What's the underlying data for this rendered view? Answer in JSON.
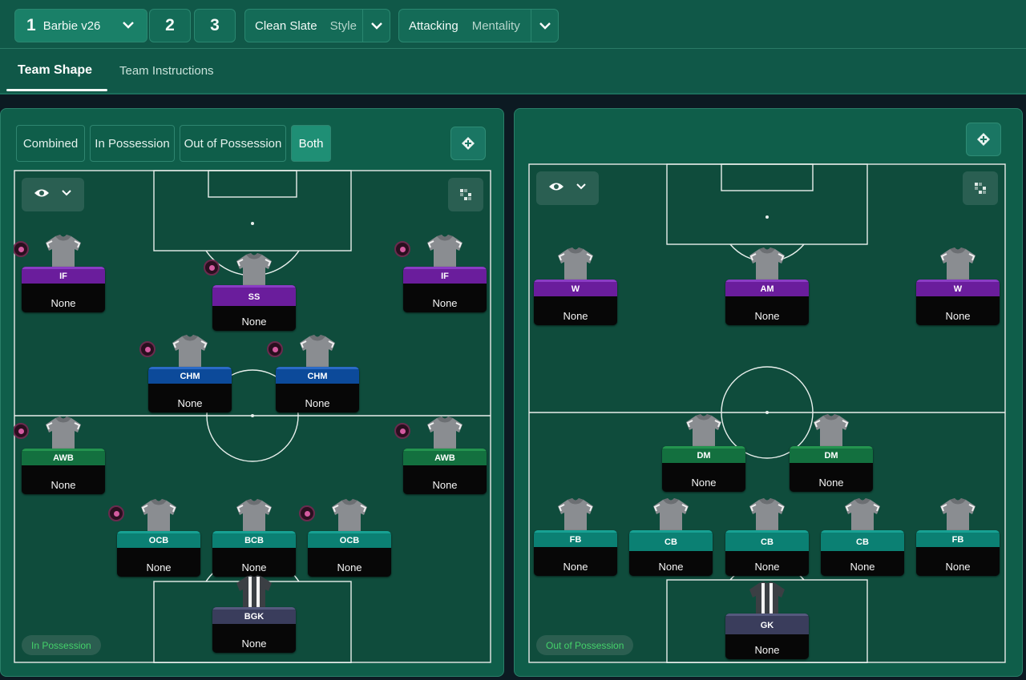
{
  "header": {
    "tactic_number": "1",
    "tactic_name": "Barbie v26",
    "slot2": "2",
    "slot3": "3",
    "style_value": "Clean Slate",
    "style_label": "Style",
    "mentality_value": "Attacking",
    "mentality_label": "Mentality",
    "tabs": [
      "Team Shape",
      "Team Instructions"
    ],
    "active_tab": "Team Shape"
  },
  "left_panel": {
    "segments": [
      "Combined",
      "In Possession",
      "Out of Possession",
      "Both"
    ],
    "active_segment": "Both",
    "phase_label": "In Possession",
    "players": [
      {
        "role": "IF",
        "name": "None",
        "color": "purple",
        "badge": true
      },
      {
        "role": "S\nS",
        "name": "None",
        "color": "purple",
        "badge": true
      },
      {
        "role": "IF",
        "name": "None",
        "color": "purple",
        "badge": true
      },
      {
        "role": "CHM",
        "name": "None",
        "color": "blue",
        "badge": true
      },
      {
        "role": "CHM",
        "name": "None",
        "color": "blue",
        "badge": true
      },
      {
        "role": "AWB",
        "name": "None",
        "color": "green",
        "badge": true
      },
      {
        "role": "AWB",
        "name": "None",
        "color": "green",
        "badge": true
      },
      {
        "role": "OCB",
        "name": "None",
        "color": "teal",
        "badge": true
      },
      {
        "role": "BCB",
        "name": "None",
        "color": "teal",
        "badge": false
      },
      {
        "role": "OCB",
        "name": "None",
        "color": "teal",
        "badge": true
      },
      {
        "role": "BGK",
        "name": "None",
        "color": "slate",
        "badge": false
      }
    ]
  },
  "right_panel": {
    "phase_label": "Out of Possession",
    "players": [
      {
        "role": "W",
        "name": "None",
        "color": "purple"
      },
      {
        "role": "AM",
        "name": "None",
        "color": "purple"
      },
      {
        "role": "W",
        "name": "None",
        "color": "purple"
      },
      {
        "role": "DM",
        "name": "None",
        "color": "green"
      },
      {
        "role": "DM",
        "name": "None",
        "color": "green"
      },
      {
        "role": "FB",
        "name": "None",
        "color": "teal"
      },
      {
        "role": "C\nB",
        "name": "None",
        "color": "teal"
      },
      {
        "role": "C\nB",
        "name": "None",
        "color": "teal"
      },
      {
        "role": "C\nB",
        "name": "None",
        "color": "teal"
      },
      {
        "role": "FB",
        "name": "None",
        "color": "teal"
      },
      {
        "role": "G\nK",
        "name": "None",
        "color": "slate"
      }
    ]
  },
  "colors": {
    "accent": "#1f8f75",
    "purple": "#6a1d9c",
    "blue": "#0c4a9a",
    "green": "#13703f",
    "teal": "#0b8073",
    "slate": "#3a3d5c",
    "possession_text": "#44d16a"
  },
  "icons": {
    "tactic_chevron": "chevron-down-icon",
    "visibility": "eye-icon",
    "grid": "grid-icon",
    "swap": "swap-diamond-icon",
    "playmaker_badge": "playmaker-badge-icon"
  }
}
